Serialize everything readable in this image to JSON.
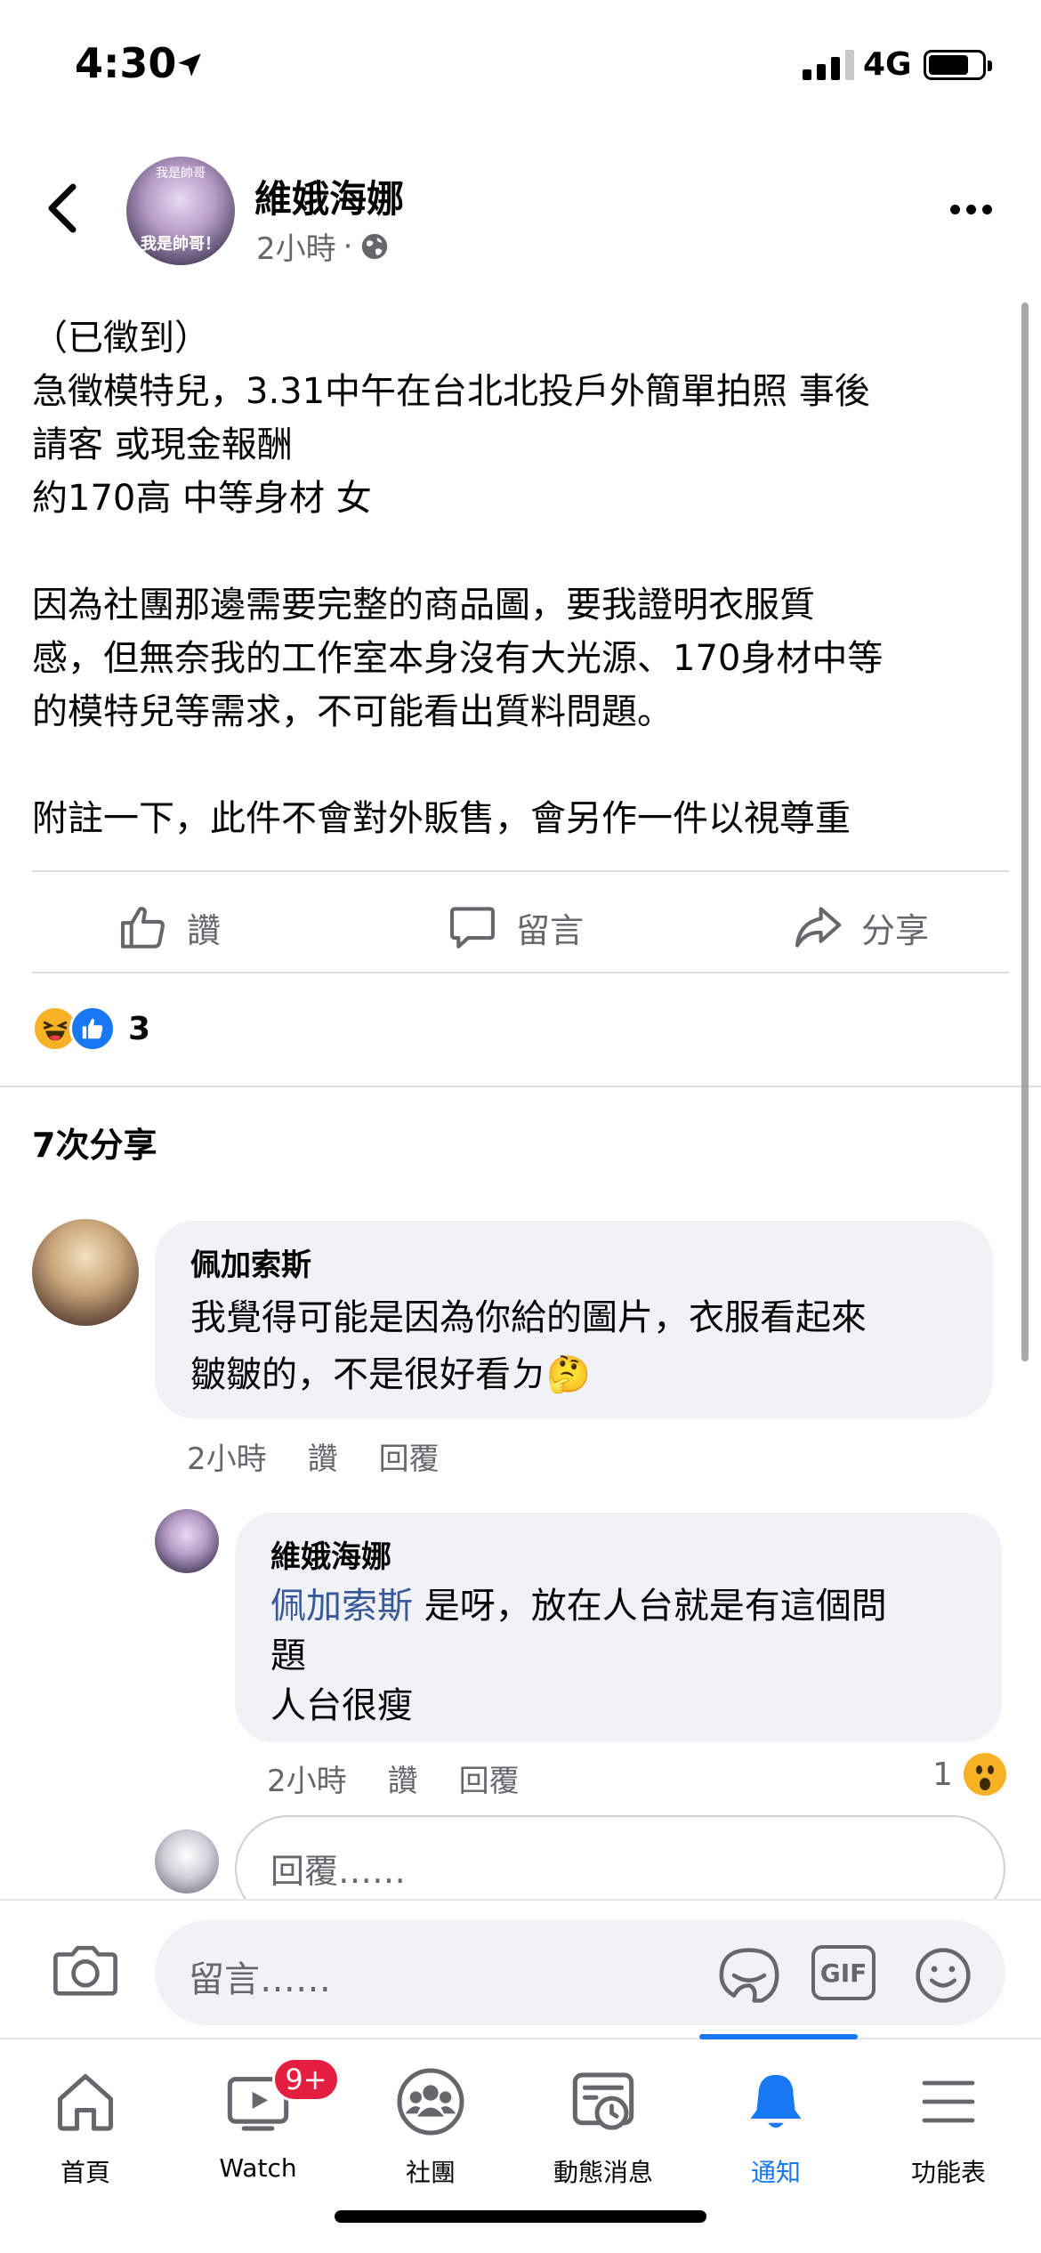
{
  "status_bar": {
    "time": "4:30",
    "network": "4G"
  },
  "header": {
    "author": "維娥海娜",
    "time_ago": "2小時",
    "separator": "·",
    "avatar_caption_top": "我是帥哥",
    "avatar_caption": "我是帥哥！"
  },
  "post": {
    "lines": [
      "（已徵到）",
      "急徵模特兒，3.31中午在台北北投戶外簡單拍照 事後",
      "請客 或現金報酬",
      "約170高 中等身材 女",
      "",
      "因為社團那邊需要完整的商品圖，要我證明衣服質",
      "感，但無奈我的工作室本身沒有大光源、170身材中等",
      "的模特兒等需求，不可能看出質料問題。",
      "",
      "附註一下，此件不會對外販售，會另作一件以視尊重"
    ]
  },
  "actions": {
    "like": "讚",
    "comment": "留言",
    "share": "分享"
  },
  "reactions": {
    "count": "3"
  },
  "shares": {
    "label": "7次分享"
  },
  "comments": [
    {
      "name": "佩加索斯",
      "line1": "我覺得可能是因為你給的圖片，衣服看起來",
      "line2": "皺皺的，不是很好看ㄉ🤔",
      "time": "2小時",
      "like": "讚",
      "reply": "回覆"
    },
    {
      "name": "維娥海娜",
      "mention": "佩加索斯",
      "line1": " 是呀，放在人台就是有這個問",
      "line2": "題",
      "line3": "人台很瘦",
      "time": "2小時",
      "like": "讚",
      "reply": "回覆",
      "reaction_count": "1"
    }
  ],
  "reply_box": {
    "placeholder": "回覆……"
  },
  "composer": {
    "placeholder": "留言……",
    "gif_label": "GIF"
  },
  "tabs": [
    {
      "label": "首頁"
    },
    {
      "label": "Watch",
      "badge": "9+"
    },
    {
      "label": "社團"
    },
    {
      "label": "動態消息"
    },
    {
      "label": "通知",
      "active": true
    },
    {
      "label": "功能表"
    }
  ],
  "colors": {
    "accent": "#1877f2",
    "badge": "#e41e3f",
    "bubble": "#f0f2f5",
    "secondary_text": "#65676b"
  }
}
